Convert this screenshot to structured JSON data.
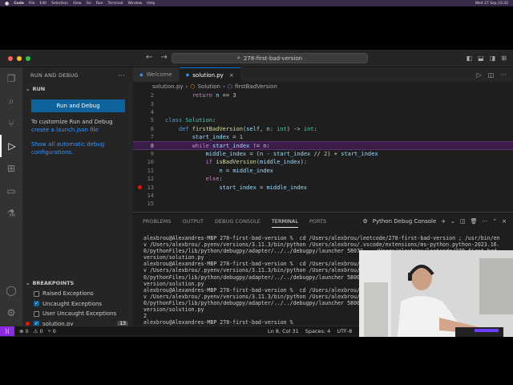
{
  "menubar": {
    "app": "Code",
    "items": [
      "File",
      "Edit",
      "Selection",
      "View",
      "Go",
      "Run",
      "Terminal",
      "Window",
      "Help"
    ],
    "clock": "Wed 27 Sep  23:32"
  },
  "titlebar": {
    "search_text": "278-first-bad-version"
  },
  "sidebar": {
    "title": "RUN AND DEBUG",
    "run_section": "RUN",
    "run_button": "Run and Debug",
    "customize_text": "To customize Run and Debug",
    "create_link": "create a launch.json file",
    "show_link": "Show all automatic debug configurations.",
    "breakpoints_title": "BREAKPOINTS",
    "breakpoints": [
      {
        "label": "Raised Exceptions",
        "checked": false
      },
      {
        "label": "Uncaught Exceptions",
        "checked": true
      },
      {
        "label": "User Uncaught Exceptions",
        "checked": false
      },
      {
        "label": "solution.py",
        "checked": true,
        "count": "13"
      }
    ]
  },
  "tabs": [
    {
      "label": "Welcome",
      "active": false
    },
    {
      "label": "solution.py",
      "active": true
    }
  ],
  "breadcrumb": [
    "solution.py",
    "Solution",
    "firstBadVersion"
  ],
  "editor": {
    "lines": [
      {
        "n": "2",
        "text": "        return n == 3"
      },
      {
        "n": "3",
        "text": ""
      },
      {
        "n": "4",
        "text": ""
      },
      {
        "n": "5",
        "text": "class Solution:"
      },
      {
        "n": "6",
        "text": "    def firstBadVersion(self, n: int) -> int:"
      },
      {
        "n": "7",
        "text": "        start_index = 1"
      },
      {
        "n": "8",
        "text": "        while start_index != n:"
      },
      {
        "n": "9",
        "text": "            middle_index = (n - start_index // 2) + start_index"
      },
      {
        "n": "10",
        "text": "            if isBadVersion(middle_index):"
      },
      {
        "n": "11",
        "text": "                n = middle_index"
      },
      {
        "n": "12",
        "text": "            else:"
      },
      {
        "n": "13",
        "text": "                start_index = middle_index"
      },
      {
        "n": "14",
        "text": ""
      },
      {
        "n": "15",
        "text": ""
      }
    ]
  },
  "panel": {
    "tabs": [
      "PROBLEMS",
      "OUTPUT",
      "DEBUG CONSOLE",
      "TERMINAL",
      "PORTS"
    ],
    "terminal_name": "Python Debug Console",
    "terminal_text": "alexbrou@Alexandres-MBP 278-first-bad-version %  cd /Users/alexbrou/leetcode/278-first-bad-version ; /usr/bin/en\nv /Users/alexbrou/.pyenv/versions/3.11.3/bin/python /Users/alexbrou/.vscode/extensions/ms-python.python-2023.16.\n0/pythonFiles/lib/python/debugpy/adapter/../../debugpy/launcher 58072 -- /Users/alexbrou/leetcode/278-first-bad-\nversion/solution.py\nalexbrou@Alexandres-MBP 278-first-bad-version %  cd /Users/alexbrou/leetcode/\nv /Users/alexbrou/.pyenv/versions/3.11.3/bin/python /Users/alexbrou/.vscode/\n0/pythonFiles/lib/python/debugpy/adapter/../../debugpy/launcher 5800\nversion/solution.py\nalexbrou@Alexandres-MBP 278-first-bad-version %  cd /Users/alexbrou/leetcode/\nv /Users/alexbrou/.pyenv/versions/3.11.3/bin/python /Users/alexbrou/.vscode/\n0/pythonFiles/lib/python/debugpy/adapter/../../debugpy/launcher 5800\nversion/solution.py\n2\nalexbrou@Alexandres-MBP 278-first-bad-version % "
  },
  "statusbar": {
    "errors": "⊗ 0",
    "warnings": "⚠ 0",
    "ports": "⑂ 0",
    "position": "Ln 8, Col 31",
    "spaces": "Spaces: 4",
    "encoding": "UTF-8"
  }
}
